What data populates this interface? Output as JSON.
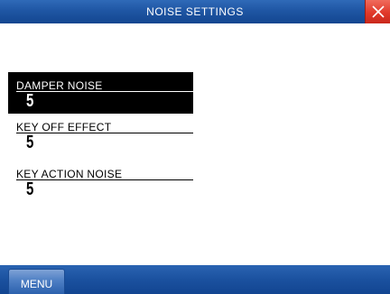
{
  "window": {
    "title": "NOISE SETTINGS",
    "close_icon": "close-x-icon"
  },
  "params": [
    {
      "label": "DAMPER NOISE",
      "value": "5",
      "selected": true
    },
    {
      "label": "KEY  OFF  EFFECT",
      "value": "5",
      "selected": false
    },
    {
      "label": "KEY  ACTION NOISE",
      "value": "5",
      "selected": false
    }
  ],
  "footer": {
    "menu_label": "MENU"
  },
  "colors": {
    "titlebar": "#1f56a4",
    "close_button": "#e0392a",
    "selected_bg": "#000000",
    "menu_button": "#4e7fc4"
  }
}
